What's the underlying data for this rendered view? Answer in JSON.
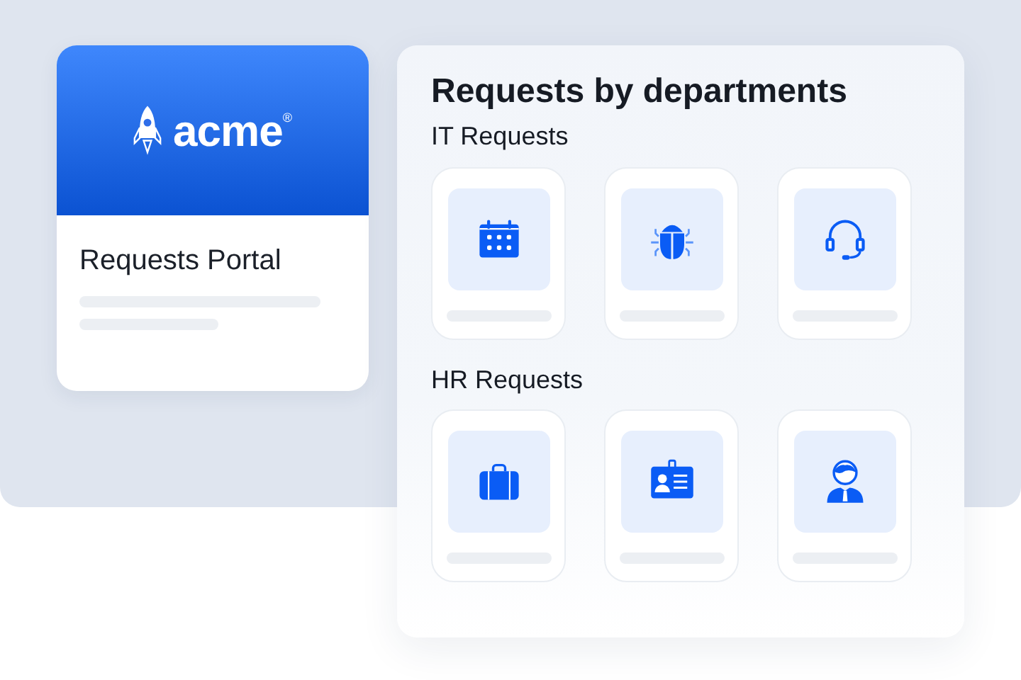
{
  "portal_card": {
    "logo": {
      "text": "acme",
      "mark": "®"
    },
    "title": "Requests Portal"
  },
  "departments_panel": {
    "title": "Requests by departments",
    "sections": [
      {
        "heading": "IT Requests",
        "tiles": [
          {
            "kind": "calendar"
          },
          {
            "kind": "bug"
          },
          {
            "kind": "headset"
          }
        ]
      },
      {
        "heading": "HR Requests",
        "tiles": [
          {
            "kind": "suitcase"
          },
          {
            "kind": "badge"
          },
          {
            "kind": "person"
          }
        ]
      }
    ]
  }
}
